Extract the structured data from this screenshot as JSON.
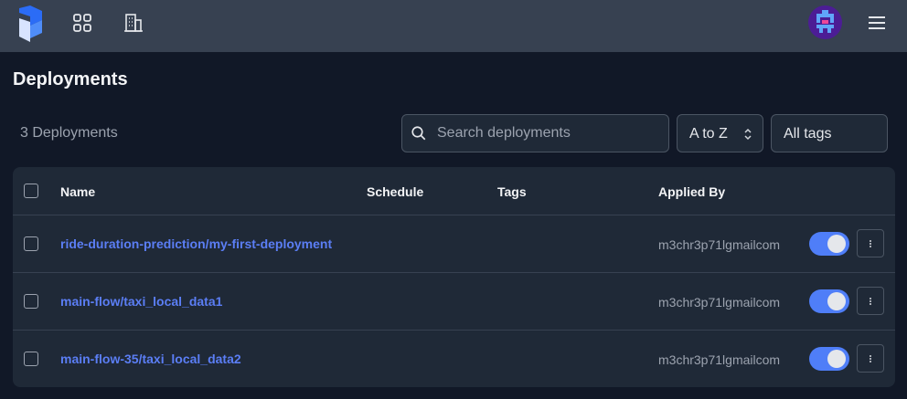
{
  "nav": {
    "logo_icon": "prefect-logo-icon",
    "dashboard_icon": "grid-icon",
    "workspaces_icon": "building-icon",
    "avatar_icon": "user-avatar",
    "menu_icon": "hamburger-menu-icon"
  },
  "page": {
    "title": "Deployments",
    "count_label": "3 Deployments"
  },
  "filters": {
    "search_placeholder": "Search deployments",
    "search_value": "",
    "sort_value": "A to Z",
    "tags_value": "All tags"
  },
  "table": {
    "headers": {
      "name": "Name",
      "schedule": "Schedule",
      "tags": "Tags",
      "applied_by": "Applied By"
    },
    "rows": [
      {
        "flow": "ride-duration-prediction",
        "deployment": "my-first-deployment",
        "schedule": "",
        "tags": "",
        "applied_by": "m3chr3p71lgmailcom",
        "active": true
      },
      {
        "flow": "main-flow",
        "deployment": "taxi_local_data1",
        "schedule": "",
        "tags": "",
        "applied_by": "m3chr3p71lgmailcom",
        "active": true
      },
      {
        "flow": "main-flow-35",
        "deployment": "taxi_local_data2",
        "schedule": "",
        "tags": "",
        "applied_by": "m3chr3p71lgmailcom",
        "active": true
      }
    ]
  },
  "colors": {
    "background": "#111827",
    "topbar": "#374151",
    "panel": "#1f2937",
    "link": "#5b7ef5",
    "toggle_on": "#4f7ef8"
  }
}
